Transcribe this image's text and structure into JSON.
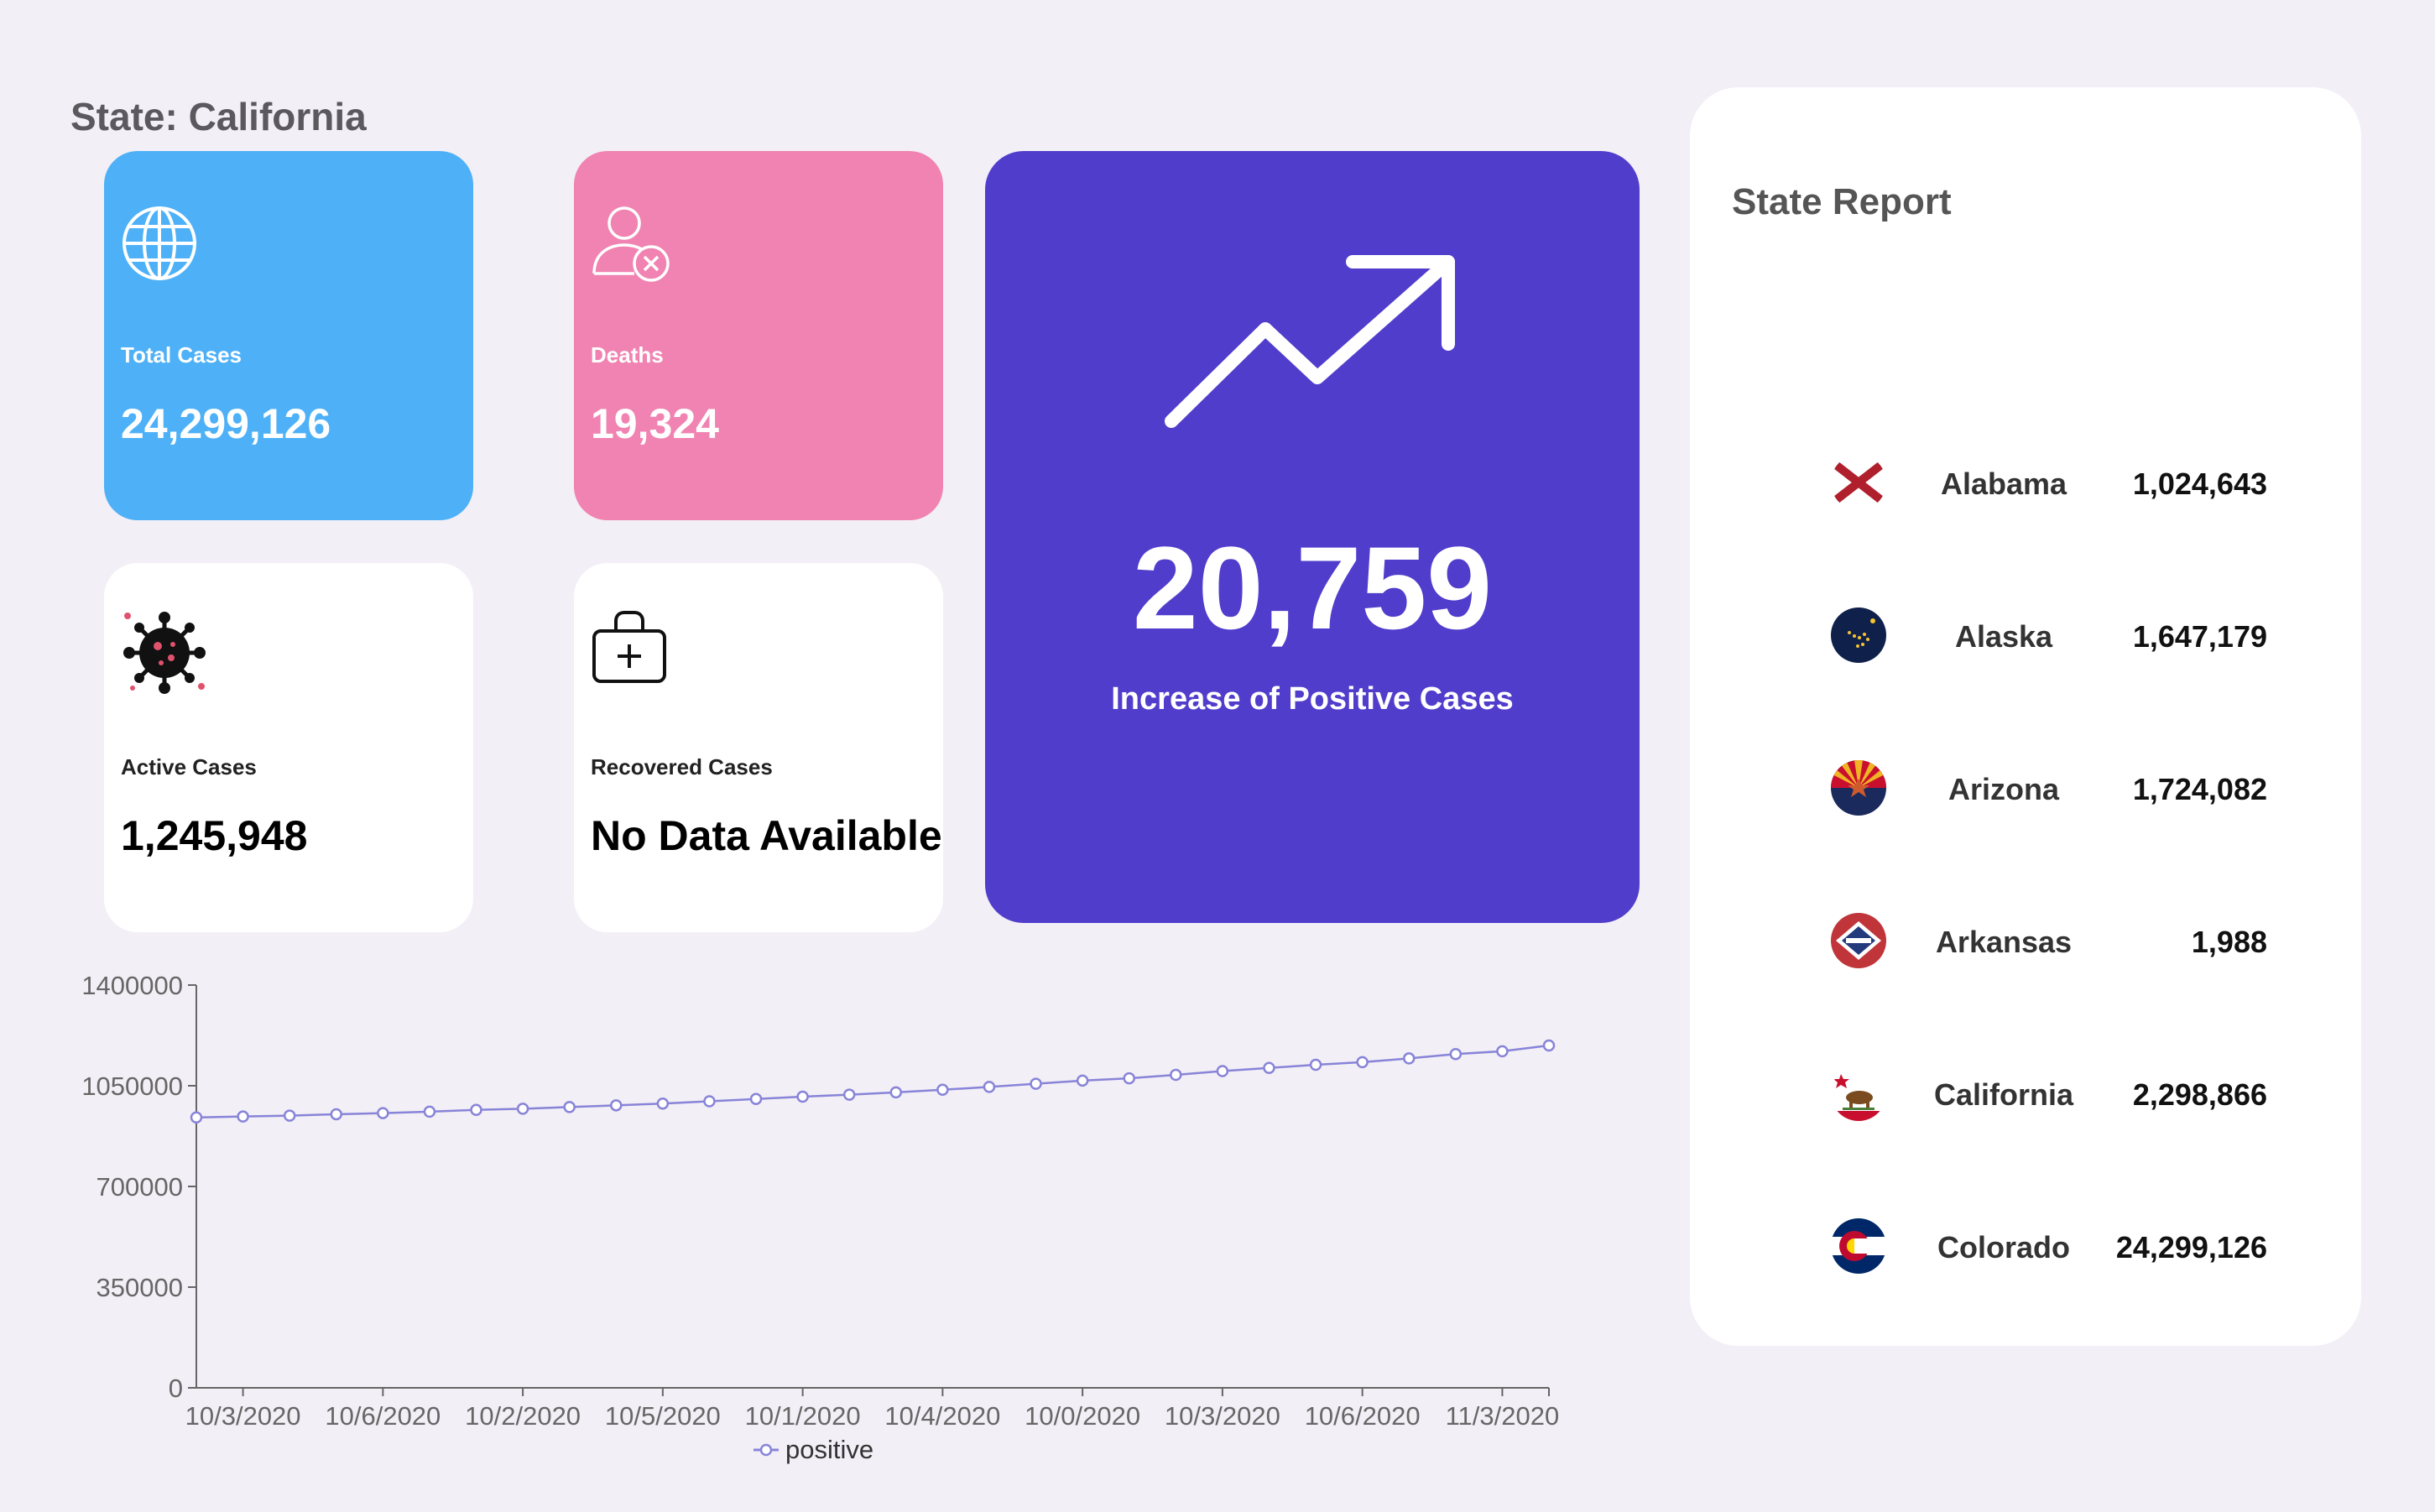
{
  "header": {
    "state_label": "State: California"
  },
  "cards": {
    "total": {
      "label": "Total Cases",
      "value": "24,299,126",
      "icon": "globe-icon"
    },
    "deaths": {
      "label": "Deaths",
      "value": "19,324",
      "icon": "user-x-icon"
    },
    "active": {
      "label": "Active Cases",
      "value": "1,245,948",
      "icon": "virus-icon"
    },
    "recovered": {
      "label": "Recovered Cases",
      "value": "No Data Available",
      "icon": "medical-bag-icon"
    }
  },
  "increase": {
    "value": "20,759",
    "label": "Increase of Positive Cases",
    "icon": "trending-up-icon"
  },
  "report": {
    "title": "State Report",
    "rows": [
      {
        "name": "Alabama",
        "value": "1,024,643",
        "flag": "alabama-flag-icon"
      },
      {
        "name": "Alaska",
        "value": "1,647,179",
        "flag": "alaska-flag-icon"
      },
      {
        "name": "Arizona",
        "value": "1,724,082",
        "flag": "arizona-flag-icon"
      },
      {
        "name": "Arkansas",
        "value": "1,988",
        "flag": "arkansas-flag-icon"
      },
      {
        "name": "California",
        "value": "2,298,866",
        "flag": "california-flag-icon"
      },
      {
        "name": "Colorado",
        "value": "24,299,126",
        "flag": "colorado-flag-icon"
      }
    ]
  },
  "colors": {
    "total_card": "#4eb1f7",
    "deaths_card": "#f083b1",
    "increase_card": "#503dcc",
    "series_line": "#8884d8"
  },
  "chart_data": {
    "type": "line",
    "x": [
      "10/3/2020",
      "",
      "10/6/2020",
      "",
      "10/2/2020",
      "",
      "10/5/2020",
      "",
      "10/1/2020",
      "",
      "10/4/2020",
      "",
      "10/0/2020",
      "",
      "10/3/2020",
      "",
      "10/6/2020",
      "",
      "11/3/2020"
    ],
    "x_points": 30,
    "xtick_labels": [
      "10/3/2020",
      "10/6/2020",
      "10/2/2020",
      "10/5/2020",
      "10/1/2020",
      "10/4/2020",
      "10/0/2020",
      "10/3/2020",
      "10/6/2020",
      "11/3/2020"
    ],
    "series": [
      {
        "name": "positive",
        "values": [
          940000,
          943000,
          946000,
          951000,
          955000,
          960000,
          966000,
          970000,
          976000,
          982000,
          988000,
          996000,
          1004000,
          1012000,
          1019000,
          1027000,
          1036000,
          1046000,
          1057000,
          1068000,
          1076000,
          1088000,
          1101000,
          1112000,
          1123000,
          1132000,
          1145000,
          1160000,
          1170000,
          1190000
        ]
      }
    ],
    "ylim": [
      0,
      1400000
    ],
    "yticks": [
      0,
      350000,
      700000,
      1050000,
      1400000
    ],
    "legend": "bottom-center",
    "grid": false
  }
}
